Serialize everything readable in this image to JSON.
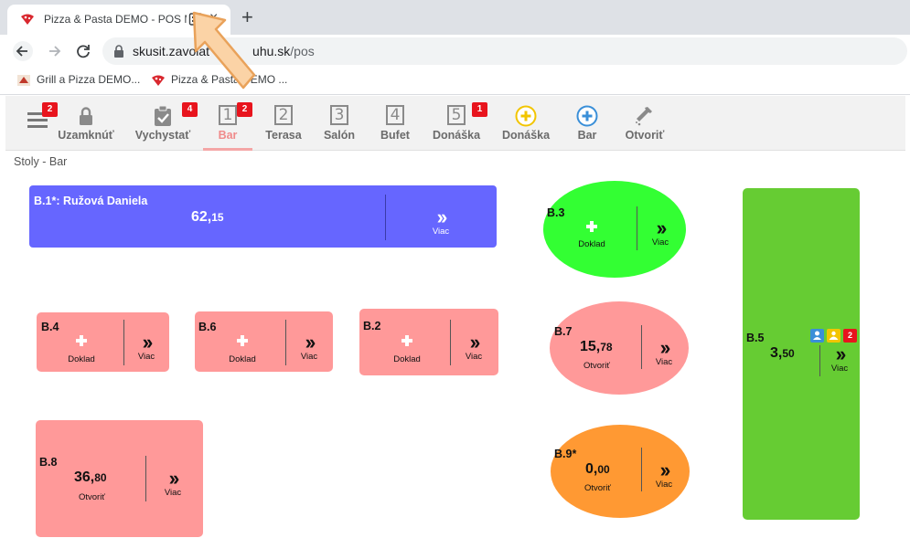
{
  "browser": {
    "tab_title": "Pizza & Pasta DEMO - POS M",
    "tab_close": "×",
    "new_tab": "+",
    "url_host": "skusit.zavolat",
    "url_mid": "uhu.sk",
    "url_path": "/pos",
    "bookmarks": [
      {
        "label": "Grill a Pizza DEMO..."
      },
      {
        "label": "Pizza & Pasta DEMO ..."
      }
    ]
  },
  "toolbar": {
    "menu_badge": "2",
    "lock_label": "Uzamknúť",
    "vychystat_label": "Vychystať",
    "vychystat_badge": "4",
    "tabs": [
      {
        "num": "1",
        "label": "Bar",
        "badge": "2"
      },
      {
        "num": "2",
        "label": "Terasa"
      },
      {
        "num": "3",
        "label": "Salón"
      },
      {
        "num": "4",
        "label": "Bufet"
      },
      {
        "num": "5",
        "label": "Donáška",
        "badge": "1"
      }
    ],
    "add_donaska_label": "Donáška",
    "add_bar_label": "Bar",
    "open_label": "Otvoriť"
  },
  "section_title": "Stoly - Bar",
  "labels": {
    "more": "Viac",
    "doklad": "Doklad",
    "otvorit": "Otvoriť"
  },
  "tables": {
    "b1": {
      "name": "B.1*: Ružová Daniela",
      "amount_main": "62,",
      "amount_cents": "15"
    },
    "b3": {
      "name": "B.3"
    },
    "b4": {
      "name": "B.4"
    },
    "b6": {
      "name": "B.6"
    },
    "b2": {
      "name": "B.2"
    },
    "b7": {
      "name": "B.7",
      "amount_main": "15,",
      "amount_cents": "78"
    },
    "b5": {
      "name": "B.5",
      "amount_main": "3,",
      "amount_cents": "50",
      "badge": "2"
    },
    "b8": {
      "name": "B.8",
      "amount_main": "36,",
      "amount_cents": "80"
    },
    "b9": {
      "name": "B.9*",
      "amount_main": "0,",
      "amount_cents": "00"
    }
  },
  "colors": {
    "blue_table": "#6666ff",
    "green_table": "#33ff33",
    "salmon_table": "#ff9999",
    "orange_table": "#ff9933",
    "lime_table": "#66cc33",
    "badge_red": "#e8141d"
  }
}
